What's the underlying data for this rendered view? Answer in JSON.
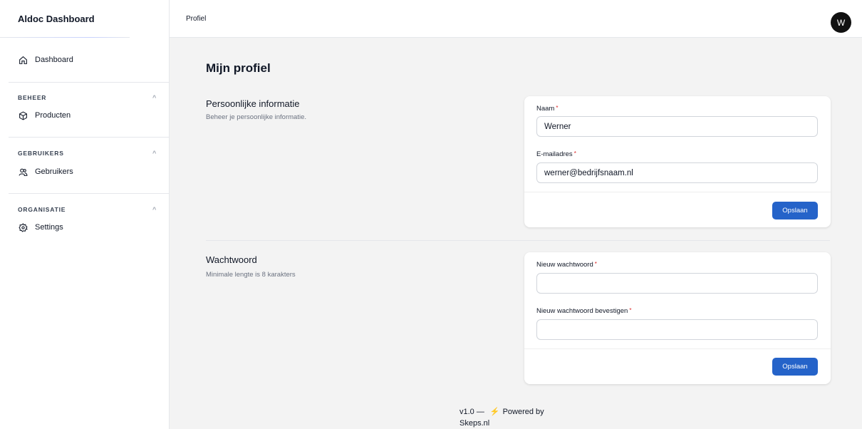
{
  "sidebar": {
    "brand": "Aldoc Dashboard",
    "dashboard_label": "Dashboard",
    "groups": [
      {
        "title": "BEHEER",
        "item": "Producten"
      },
      {
        "title": "GEBRUIKERS",
        "item": "Gebruikers"
      },
      {
        "title": "ORGANISATIE",
        "item": "Settings"
      }
    ],
    "chevron": "^"
  },
  "topbar": {
    "title": "Profiel",
    "avatar_initial": "W"
  },
  "main": {
    "page_title": "Mijn profiel",
    "personal": {
      "title": "Persoonlijke informatie",
      "description": "Beheer je persoonlijke informatie.",
      "name_label": "Naam",
      "name_value": "Werner",
      "email_label": "E-mailadres",
      "email_value": "werner@bedrijfsnaam.nl",
      "save_label": "Opslaan"
    },
    "password": {
      "title": "Wachtwoord",
      "description": "Minimale lengte is 8 karakters",
      "new_label": "Nieuw wachtwoord",
      "new_value": "",
      "confirm_label": "Nieuw wachtwoord bevestigen",
      "confirm_value": "",
      "save_label": "Opslaan"
    },
    "required_mark": "*"
  },
  "footer": {
    "version": "v1.0 —",
    "bolt": "⚡",
    "powered": "Powered by",
    "company": "Skeps.nl"
  },
  "colors": {
    "primary": "#2563c9",
    "required": "#dc2626",
    "background": "#f3f3f3"
  }
}
